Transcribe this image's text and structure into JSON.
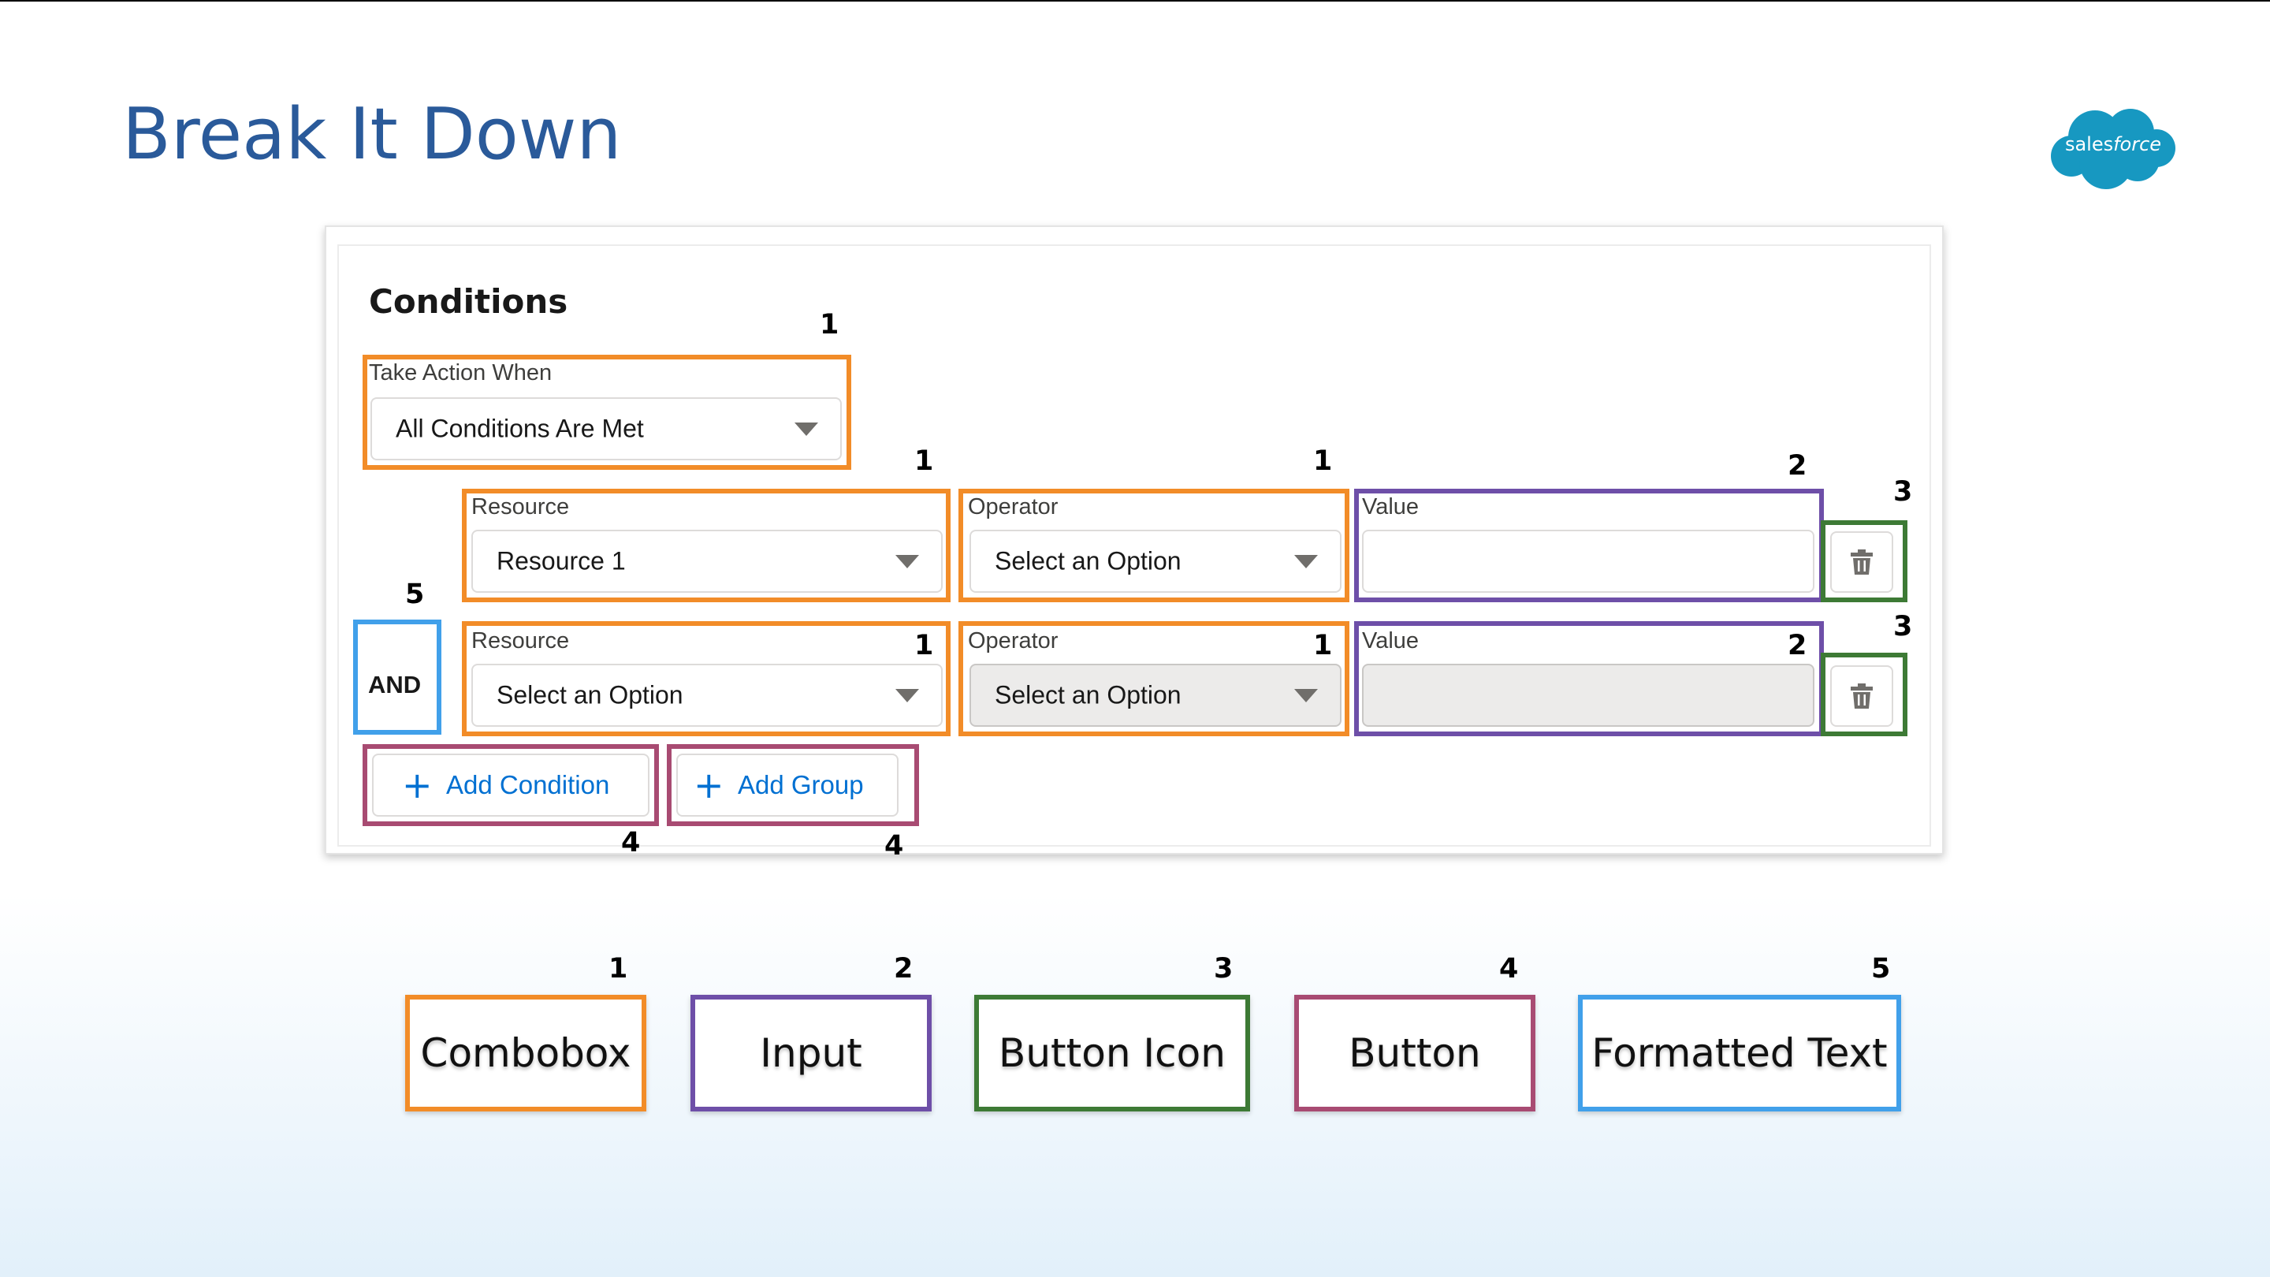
{
  "slide": {
    "title": "Break It Down",
    "logo": {
      "brand": "sales",
      "brand_suffix": "force",
      "icon": "salesforce-cloud-logo",
      "color": "#1798c1"
    }
  },
  "conditions": {
    "title": "Conditions",
    "take_action": {
      "label": "Take Action When",
      "value": "All Conditions Are Met"
    },
    "and_label": "AND",
    "rows": [
      {
        "resource": {
          "label": "Resource",
          "value": "Resource 1"
        },
        "operator": {
          "label": "Operator",
          "value": "Select an Option"
        },
        "value_field": {
          "label": "Value",
          "value": ""
        },
        "delete_icon": "trash-icon"
      },
      {
        "resource": {
          "label": "Resource",
          "value": "Select an Option"
        },
        "operator": {
          "label": "Operator",
          "value": "Select an Option"
        },
        "value_field": {
          "label": "Value",
          "value": ""
        },
        "delete_icon": "trash-icon"
      }
    ],
    "add_condition_label": "Add Condition",
    "add_group_label": "Add Group"
  },
  "callouts": {
    "combobox": "1",
    "input": "2",
    "button_icon": "3",
    "button": "4",
    "formatted_text": "5"
  },
  "legend": [
    {
      "num": "1",
      "label": "Combobox",
      "color": "#f28c28"
    },
    {
      "num": "2",
      "label": "Input",
      "color": "#6e4fa8"
    },
    {
      "num": "3",
      "label": "Button Icon",
      "color": "#3d7a35"
    },
    {
      "num": "4",
      "label": "Button",
      "color": "#a84b72"
    },
    {
      "num": "5",
      "label": "Formatted Text",
      "color": "#41a0ea"
    }
  ],
  "colors": {
    "title": "#2a5a9a",
    "link_blue": "#0070d2",
    "combobox": "#f28c28",
    "input": "#6e4fa8",
    "button_icon": "#3d7a35",
    "button": "#a84b72",
    "formatted_text": "#41a0ea"
  }
}
